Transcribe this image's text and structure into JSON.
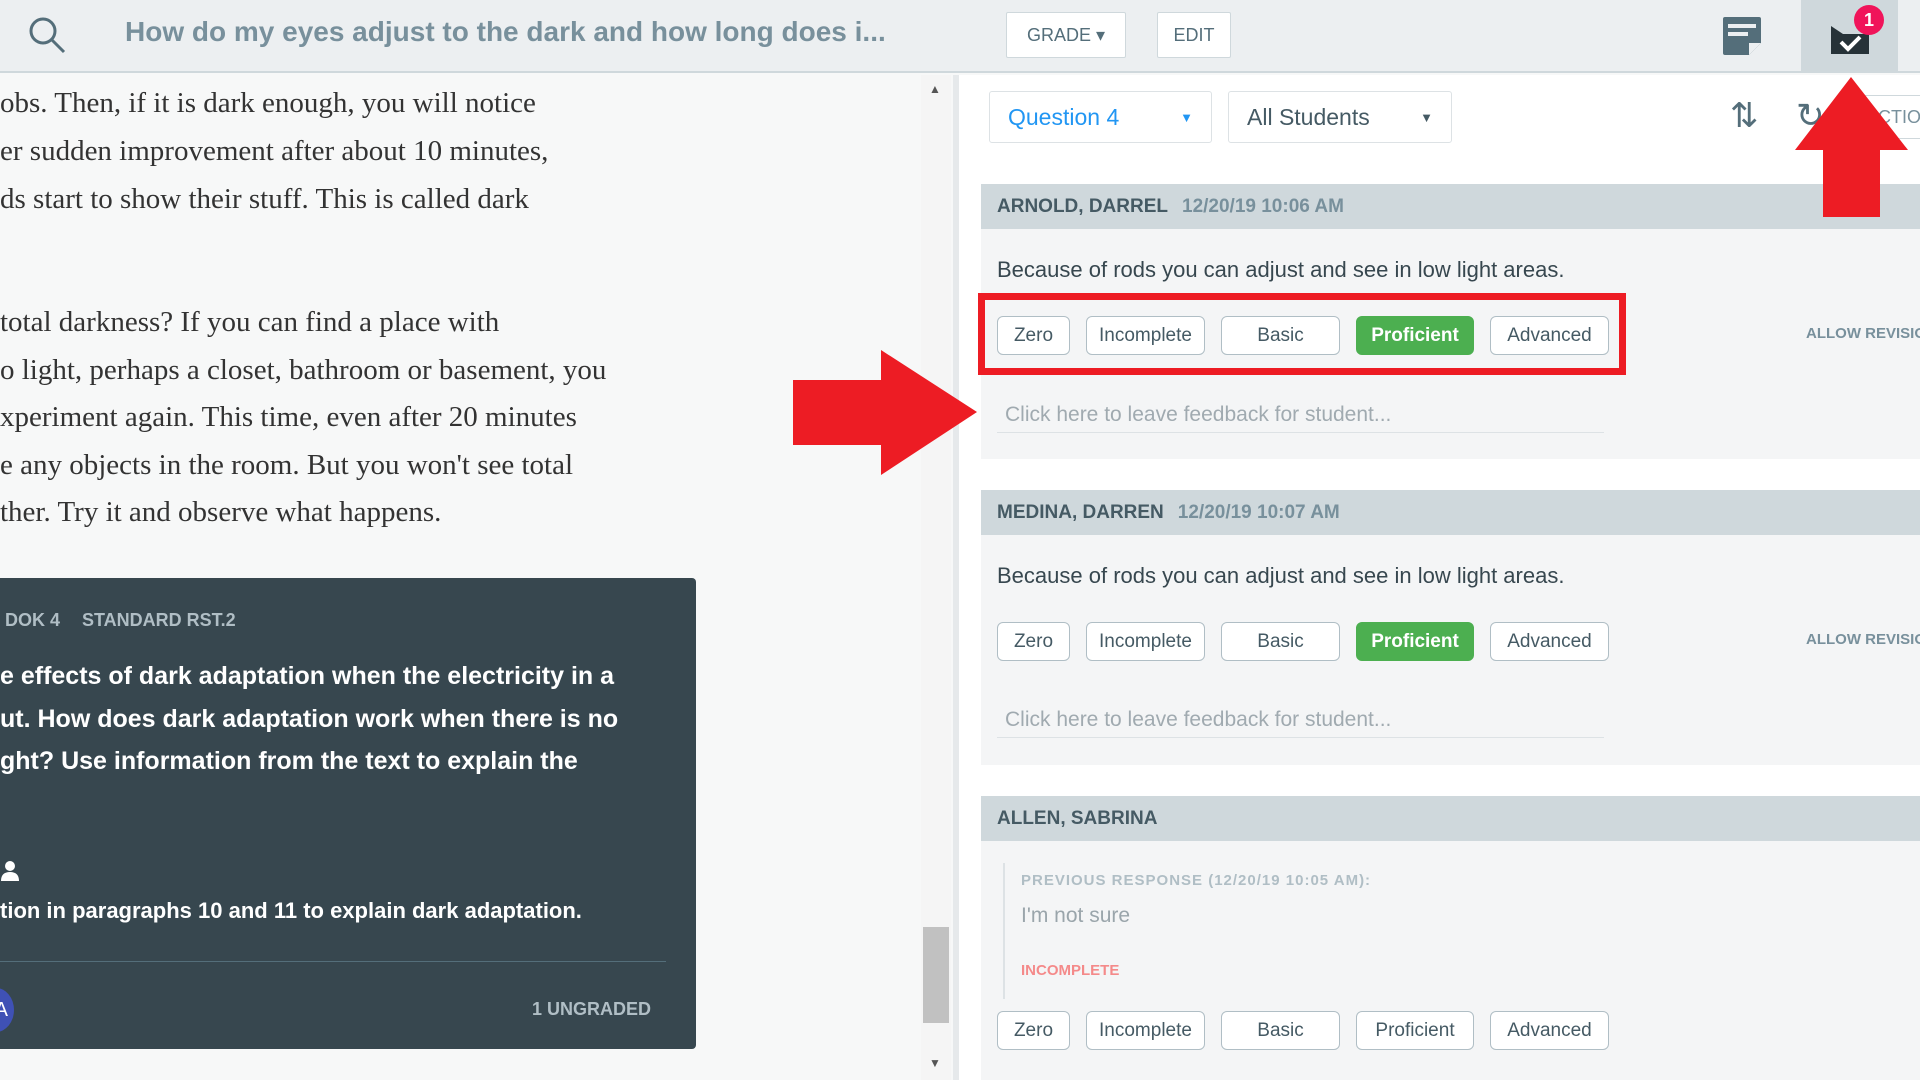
{
  "header": {
    "title": "How do my eyes adjust to the dark and how long does i...",
    "grade_label": "GRADE ▾",
    "edit_label": "EDIT",
    "notification_count": "1"
  },
  "reading": {
    "lines_top": [
      "obs. Then, if it is dark enough, you will notice",
      "er sudden improvement after about 10 minutes,",
      "ds start to show their stuff. This is called dark"
    ],
    "lines_bottom": [
      "total darkness? If you can find a place with",
      "o light, perhaps a closet, bathroom or basement, you",
      "xperiment again. This time, even after 20 minutes",
      "e any objects in the room. But you won't see total",
      "ther. Try it and observe what happens."
    ]
  },
  "question_card": {
    "dok": "DOK 4",
    "standard": "STANDARD RST.2",
    "question_lines": [
      "e effects of dark adaptation when the electricity in a",
      "ut. How does dark adaptation work when there is no",
      "ght? Use information from the text to explain the"
    ],
    "hint": "tion in paragraphs 10 and 11 to explain dark adaptation.",
    "avatar_letter": "A",
    "ungraded": "1 UNGRADED"
  },
  "filters": {
    "question": "Question 4",
    "students": "All Students",
    "actions_label": "ACTIONS"
  },
  "grade_options": [
    "Zero",
    "Incomplete",
    "Basic",
    "Proficient",
    "Advanced"
  ],
  "feedback_placeholder": "Click here to leave feedback for student...",
  "allow_revision": "ALLOW REVISION",
  "students": [
    {
      "name": "ARNOLD, DARREL",
      "timestamp": "12/20/19 10:06 AM",
      "response": "Because of rods you can adjust and see in low light areas.",
      "selected": "Proficient"
    },
    {
      "name": "MEDINA, DARREN",
      "timestamp": "12/20/19 10:07 AM",
      "response": "Because of rods you can adjust and see in low light areas.",
      "selected": "Proficient"
    },
    {
      "name": "ALLEN, SABRINA",
      "previous_label": "PREVIOUS RESPONSE (12/20/19 10:05 AM):",
      "previous_response": "I'm not sure",
      "previous_grade": "INCOMPLETE",
      "selected": null
    }
  ],
  "colors": {
    "proficient": "#4caf50",
    "annotation": "#ed1c24",
    "badge": "#f0145a",
    "card_dark": "#37474f",
    "link": "#2196f3"
  }
}
